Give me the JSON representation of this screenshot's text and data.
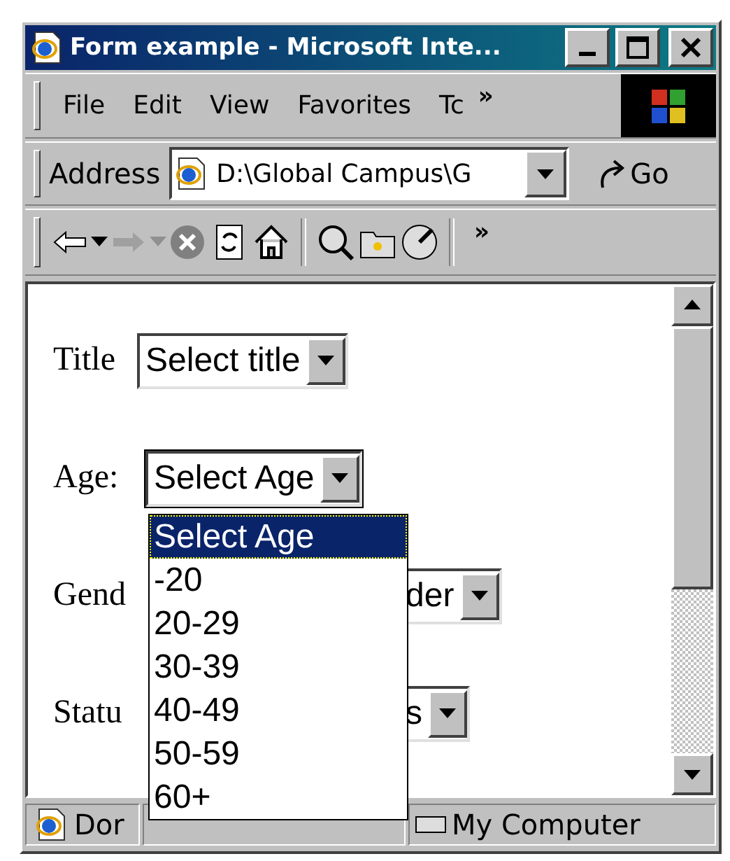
{
  "window": {
    "title": "Form example - Microsoft Inte..."
  },
  "menu": {
    "items": [
      {
        "label": "File"
      },
      {
        "label": "Edit"
      },
      {
        "label": "View"
      },
      {
        "label": "Favorites"
      },
      {
        "label": "Tc"
      }
    ],
    "more": "»"
  },
  "address": {
    "label": "Address",
    "value": "D:\\Global Campus\\G",
    "go": "Go"
  },
  "toolbar": {
    "more": "»"
  },
  "form": {
    "rows": [
      {
        "kind": "plain",
        "label": "Title",
        "select": "Select title",
        "expanded": false
      },
      {
        "kind": "plain",
        "label": "Age:",
        "select": "Select Age",
        "expanded": true
      },
      {
        "kind": "covered",
        "label": "Gend",
        "select": "der",
        "expanded": false
      },
      {
        "kind": "covered",
        "label": "Statu",
        "select": "s",
        "expanded": false
      }
    ]
  },
  "dropdown": {
    "options": [
      {
        "label": "Select Age",
        "selected": true
      },
      {
        "label": "-20",
        "selected": false
      },
      {
        "label": "20-29",
        "selected": false
      },
      {
        "label": "30-39",
        "selected": false
      },
      {
        "label": "40-49",
        "selected": false
      },
      {
        "label": "50-59",
        "selected": false
      },
      {
        "label": "60+",
        "selected": false
      }
    ]
  },
  "status_bar": {
    "text": "Dor",
    "zone": "My Computer"
  }
}
